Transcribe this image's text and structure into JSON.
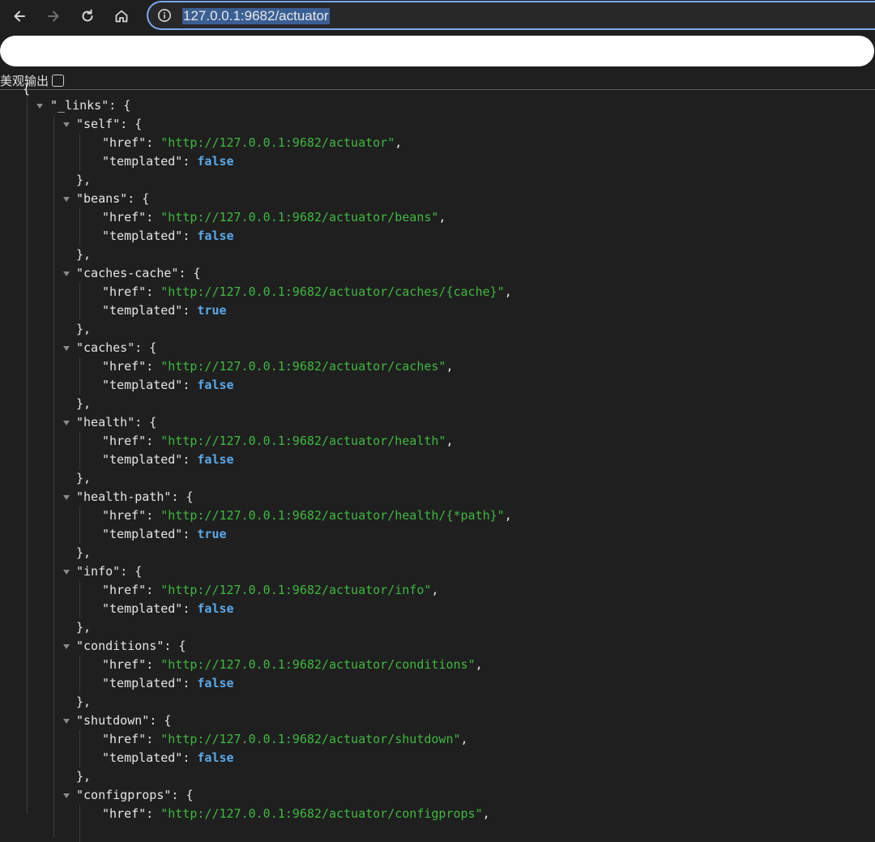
{
  "browser": {
    "url": "127.0.0.1:9682/actuator"
  },
  "controls": {
    "pretty_print_label": "美观输出"
  },
  "json": {
    "root_open": "{",
    "links_key": "\"_links\"",
    "entries": [
      {
        "key": "\"self\"",
        "href": "\"http://127.0.0.1:9682/actuator\"",
        "templated": "false"
      },
      {
        "key": "\"beans\"",
        "href": "\"http://127.0.0.1:9682/actuator/beans\"",
        "templated": "false"
      },
      {
        "key": "\"caches-cache\"",
        "href": "\"http://127.0.0.1:9682/actuator/caches/{cache}\"",
        "templated": "true"
      },
      {
        "key": "\"caches\"",
        "href": "\"http://127.0.0.1:9682/actuator/caches\"",
        "templated": "false"
      },
      {
        "key": "\"health\"",
        "href": "\"http://127.0.0.1:9682/actuator/health\"",
        "templated": "false"
      },
      {
        "key": "\"health-path\"",
        "href": "\"http://127.0.0.1:9682/actuator/health/{*path}\"",
        "templated": "true"
      },
      {
        "key": "\"info\"",
        "href": "\"http://127.0.0.1:9682/actuator/info\"",
        "templated": "false"
      },
      {
        "key": "\"conditions\"",
        "href": "\"http://127.0.0.1:9682/actuator/conditions\"",
        "templated": "false"
      },
      {
        "key": "\"shutdown\"",
        "href": "\"http://127.0.0.1:9682/actuator/shutdown\"",
        "templated": "false"
      },
      {
        "key": "\"configprops\"",
        "href": "\"http://127.0.0.1:9682/actuator/configprops\"",
        "templated": ""
      }
    ],
    "href_key": "\"href\"",
    "templated_key": "\"templated\""
  }
}
